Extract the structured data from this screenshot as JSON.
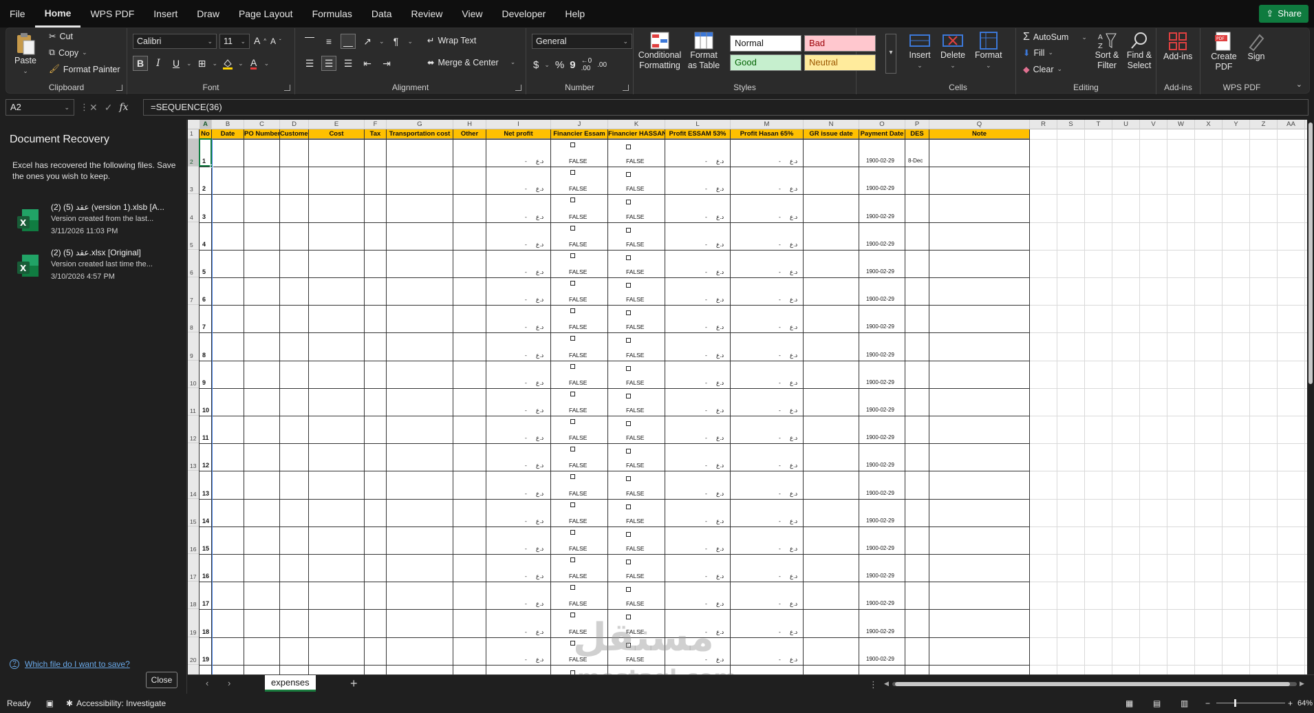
{
  "menu": {
    "items": [
      "File",
      "Home",
      "WPS PDF",
      "Insert",
      "Draw",
      "Page Layout",
      "Formulas",
      "Data",
      "Review",
      "View",
      "Developer",
      "Help"
    ],
    "active": "Home",
    "share": "Share"
  },
  "ribbon": {
    "clipboard": {
      "paste": "Paste",
      "cut": "Cut",
      "copy": "Copy",
      "format_painter": "Format Painter",
      "label": "Clipboard"
    },
    "font": {
      "name": "Calibri",
      "size": "11",
      "grow": "A",
      "shrink": "A",
      "bold": "B",
      "italic": "I",
      "underline": "U",
      "font_color_letter": "A",
      "label": "Font"
    },
    "alignment": {
      "wrap": "Wrap Text",
      "merge": "Merge & Center",
      "label": "Alignment"
    },
    "number": {
      "format": "General",
      "currency": "$",
      "percent": "%",
      "comma": "9",
      "inc_dec": ".00",
      "label": "Number"
    },
    "styles": {
      "cond": "Conditional Formatting",
      "table": "Format as Table",
      "normal": "Normal",
      "bad": "Bad",
      "good": "Good",
      "neutral": "Neutral",
      "label": "Styles"
    },
    "cells": {
      "insert": "Insert",
      "delete": "Delete",
      "format": "Format",
      "label": "Cells"
    },
    "editing": {
      "autosum": "AutoSum",
      "fill": "Fill",
      "clear": "Clear",
      "sort": "Sort & Filter",
      "find": "Find & Select",
      "label": "Editing"
    },
    "addins": {
      "addins": "Add-ins",
      "label": "Add-ins"
    },
    "wps": {
      "create": "Create PDF",
      "sign": "Sign",
      "label": "WPS PDF"
    }
  },
  "formula_bar": {
    "name_box": "A2",
    "fx": "fx",
    "formula": "=SEQUENCE(36)"
  },
  "recovery": {
    "title": "Document Recovery",
    "desc": "Excel has recovered the following files.  Save the ones you wish to keep.",
    "files": [
      {
        "name": "(2) (5) عقد (version 1).xlsb  [A...",
        "sub": "Version created from the last...",
        "date": "3/11/2026 11:03 PM"
      },
      {
        "name": "(2) (5) عقد.xlsx  [Original]",
        "sub": "Version created last time the...",
        "date": "3/10/2026 4:57 PM"
      }
    ],
    "link": "Which file do I want to save?",
    "close": "Close"
  },
  "sheet": {
    "columns": [
      "A",
      "B",
      "C",
      "D",
      "E",
      "F",
      "G",
      "H",
      "I",
      "J",
      "K",
      "L",
      "M",
      "N",
      "O",
      "P",
      "Q",
      "R",
      "S",
      "T",
      "U",
      "V",
      "W",
      "X",
      "Y",
      "Z",
      "AA"
    ],
    "headers": [
      "No",
      "Date",
      "PO Number",
      "Customer",
      "Cost",
      "Tax",
      "Transportation cost",
      "Other",
      "Net profit",
      "Financier Essam",
      "Financier HASSAN",
      "Profit ESSAM 53%",
      "Profit Hasan 65%",
      "GR issue date",
      "Payment Date",
      "DES",
      "Note"
    ],
    "row_numbers": [
      "1",
      "2",
      "3",
      "4",
      "5",
      "6",
      "7",
      "8",
      "9",
      "10",
      "11",
      "12",
      "13",
      "14",
      "15",
      "16",
      "17",
      "18",
      "19",
      "20"
    ],
    "seq": [
      "1",
      "2",
      "3",
      "4",
      "5",
      "6",
      "7",
      "8",
      "9",
      "10",
      "11",
      "12",
      "13",
      "14",
      "15",
      "16",
      "17",
      "18",
      "19"
    ],
    "false_text": "FALSE",
    "dash": "-",
    "currency": "د.ع",
    "payment_date": "1900-02-29",
    "des_first": "8-Dec"
  },
  "tabs": {
    "active": "expenses",
    "add": "+"
  },
  "status": {
    "ready": "Ready",
    "accessibility": "Accessibility: Investigate",
    "zoom": "64%"
  },
  "watermark": {
    "arabic": "مستقل",
    "latin": "mostaql.com"
  }
}
